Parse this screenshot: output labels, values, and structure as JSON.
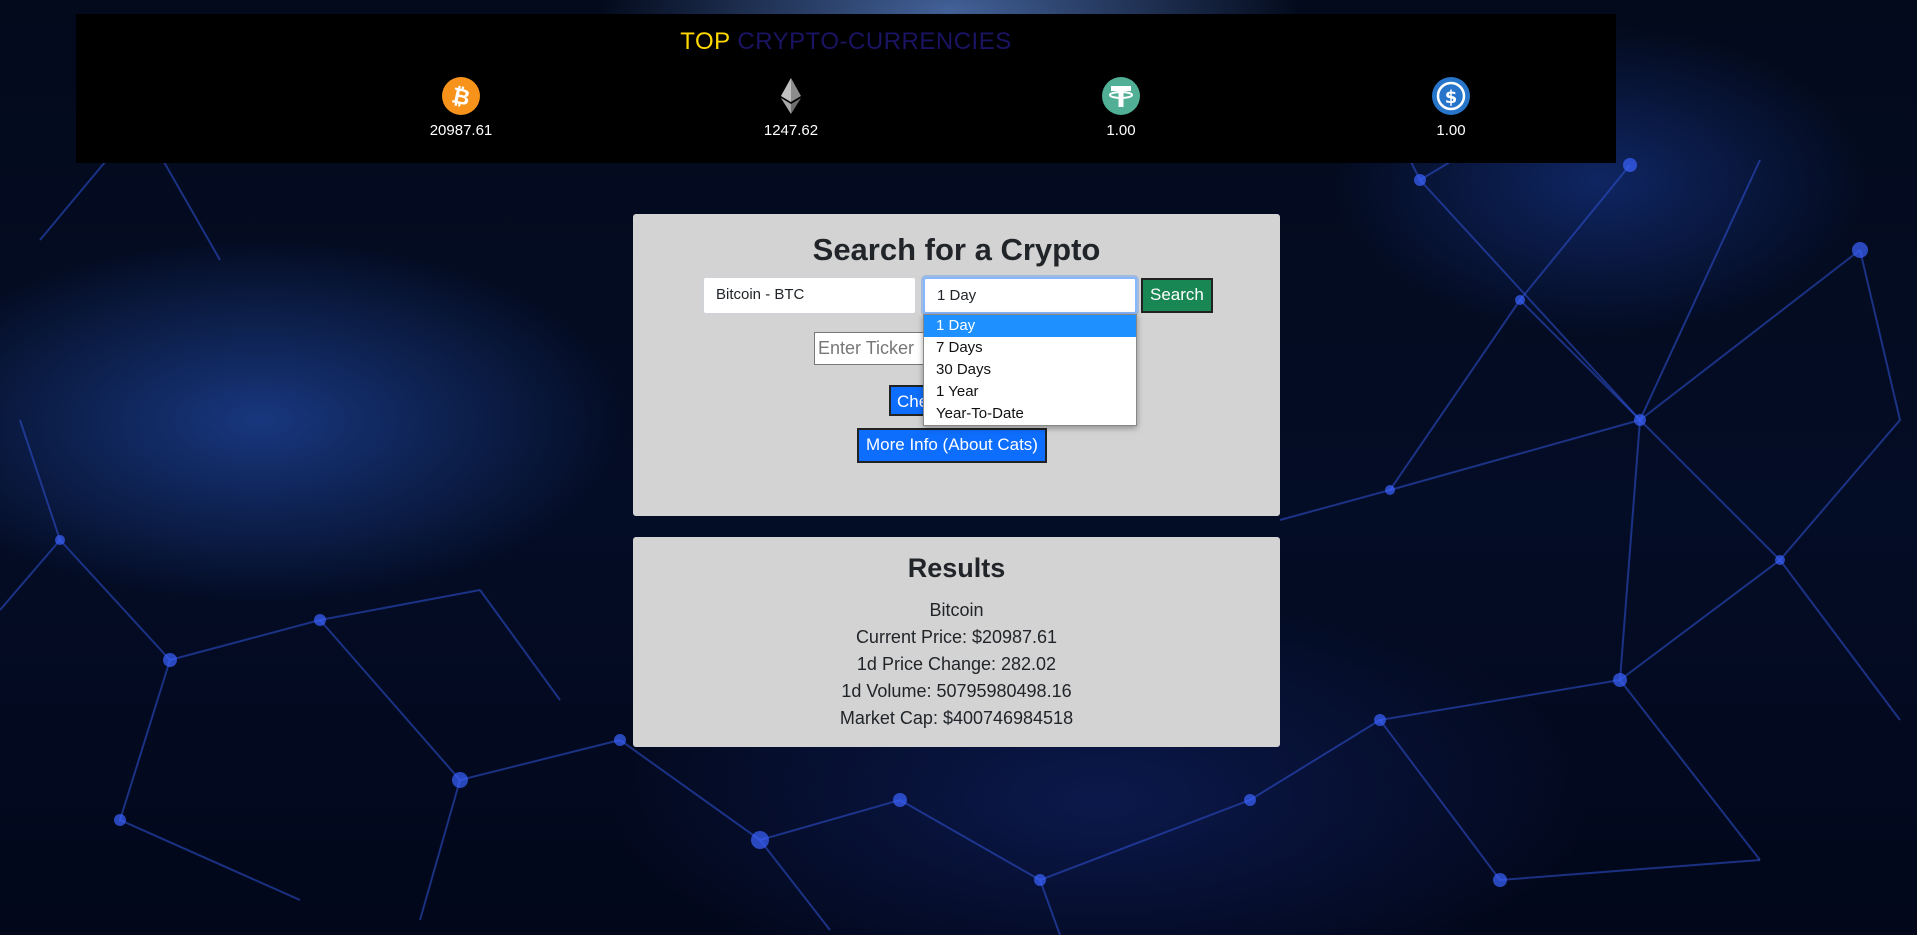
{
  "ticker": {
    "title_part1": "TOP",
    "title_part2": "CRYPTO-CURRENCIES",
    "coins": [
      {
        "icon": "bitcoin-icon",
        "price": "20987.61",
        "color": "#f7931a"
      },
      {
        "icon": "ethereum-icon",
        "price": "1247.62",
        "color": "#8c8c8c"
      },
      {
        "icon": "tether-icon",
        "price": "1.00",
        "color": "#50af95"
      },
      {
        "icon": "usd-coin-icon",
        "price": "1.00",
        "color": "#2775ca"
      }
    ]
  },
  "search": {
    "title": "Search for a Crypto",
    "coin_select_value": "Bitcoin - BTC",
    "range_select_value": "1 Day",
    "search_button": "Search",
    "ticker_placeholder": "Enter Ticker",
    "check_button": "Check",
    "more_info_button": "More Info (About Cats)",
    "range_options": [
      "1 Day",
      "7 Days",
      "30 Days",
      "1 Year",
      "Year-To-Date"
    ]
  },
  "results": {
    "title": "Results",
    "name": "Bitcoin",
    "current_price": "Current Price: $20987.61",
    "price_change": "1d Price Change: 282.02",
    "volume": "1d Volume: 50795980498.16",
    "market_cap": "Market Cap: $400746984518"
  },
  "colors": {
    "search_green": "#198754",
    "primary_blue": "#0d6efd",
    "title_yellow": "#ffd800",
    "title_navy": "#1a1463",
    "panel_gray": "#d3d3d3"
  }
}
